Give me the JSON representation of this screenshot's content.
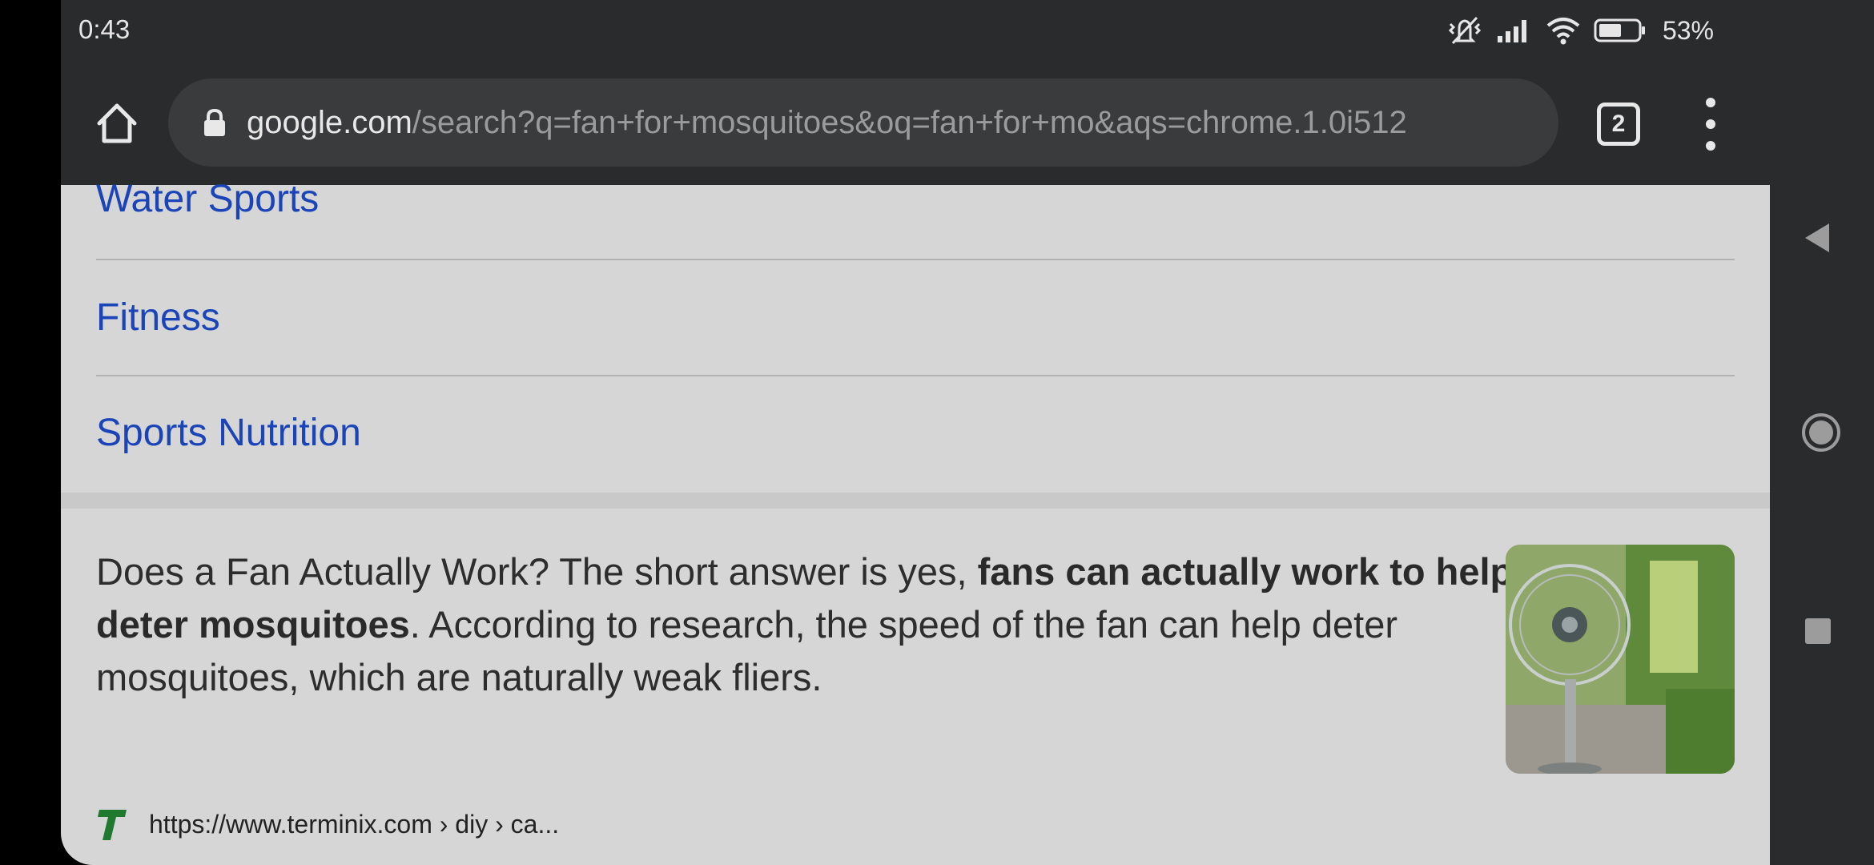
{
  "status_bar": {
    "time": "0:43",
    "battery": "53%",
    "icons": [
      "silent-vibrate-icon",
      "signal-icon",
      "wifi-icon",
      "battery-icon"
    ]
  },
  "browser": {
    "url_domain": "google.com",
    "url_path": "/search?q=fan+for+mosquitoes&oq=fan+for+mo&aqs=chrome.1.0i512",
    "tab_count": "2"
  },
  "categories": [
    {
      "label": "Water Sports"
    },
    {
      "label": "Fitness"
    },
    {
      "label": "Sports Nutrition"
    }
  ],
  "featured_snippet": {
    "text_start": "Does a Fan Actually Work? The short answer is yes, ",
    "text_bold": "fans can actually work to help deter mosquitoes",
    "text_end": ". According to research, the speed of the fan can help deter mosquitoes, which are naturally weak fliers.",
    "source_url": "https://www.terminix.com › diy › ca..."
  },
  "colors": {
    "link": "#1a44b8",
    "chrome_bar": "#2a2b2d",
    "page_bg": "#d6d6d6"
  }
}
